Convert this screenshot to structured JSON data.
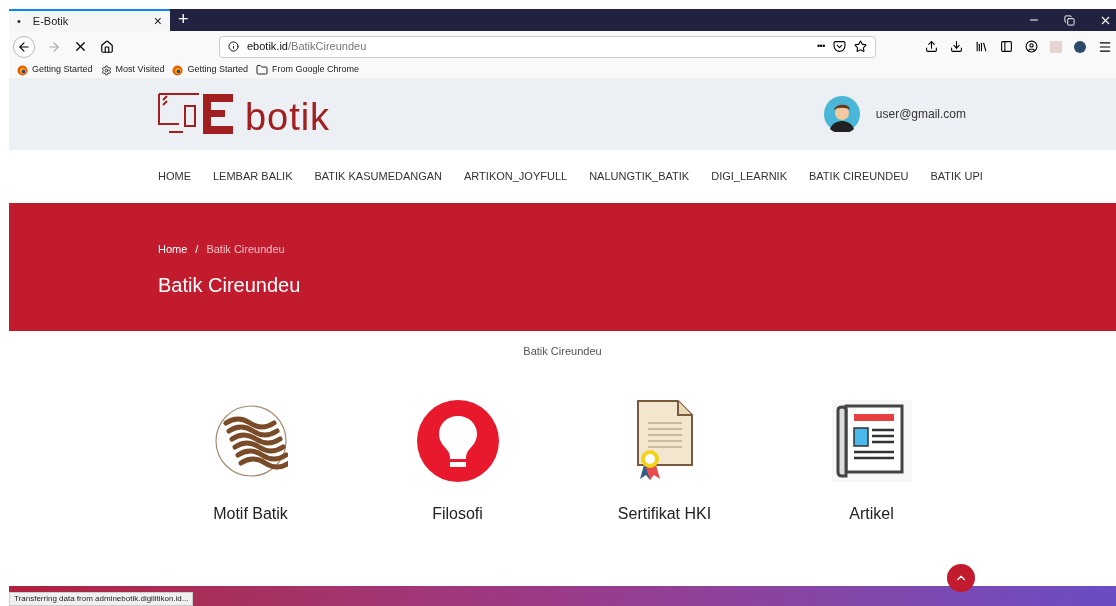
{
  "browser": {
    "tab": {
      "title": "E-Botik",
      "bullet": "•",
      "close": "×"
    },
    "new_tab": "+",
    "address": {
      "domain": "ebotik.id",
      "path": "/BatikCireundeu"
    },
    "page_actions": "•••",
    "bookmarks": [
      {
        "label": "Getting Started",
        "kind": "firefox"
      },
      {
        "label": "Most Visited",
        "kind": "gear"
      },
      {
        "label": "Getting Started",
        "kind": "firefox"
      },
      {
        "label": "From Google Chrome",
        "kind": "folder"
      }
    ],
    "status": "Transferring data from adminebotik.digilitikon.id..."
  },
  "header": {
    "logo_text": "botik",
    "user_email": "user@gmail.com"
  },
  "nav": [
    {
      "label": "HOME",
      "selected": false
    },
    {
      "label": "LEMBAR BALIK",
      "selected": false
    },
    {
      "label": "BATIK KASUMEDANGAN",
      "selected": false
    },
    {
      "label": "ARTIKON_JOYFULL",
      "selected": false
    },
    {
      "label": "NALUNGTIK_BATIK",
      "selected": false
    },
    {
      "label": "DIGI_LEARNIK",
      "selected": false
    },
    {
      "label": "BATIK CIREUNDEU",
      "selected": false
    },
    {
      "label": "BATIK UPI",
      "selected": false
    }
  ],
  "hero": {
    "breadcrumb": [
      "Home",
      "Batik Cireundeu"
    ],
    "separator": "/",
    "title": "Batik Cireundeu"
  },
  "section_label": "Batik Cireundeu",
  "cards": [
    {
      "label": "Motif Batik",
      "kind": "motif"
    },
    {
      "label": "Filosofi",
      "kind": "bulb"
    },
    {
      "label": "Sertifikat HKI",
      "kind": "certificate"
    },
    {
      "label": "Artikel",
      "kind": "newspaper"
    }
  ]
}
